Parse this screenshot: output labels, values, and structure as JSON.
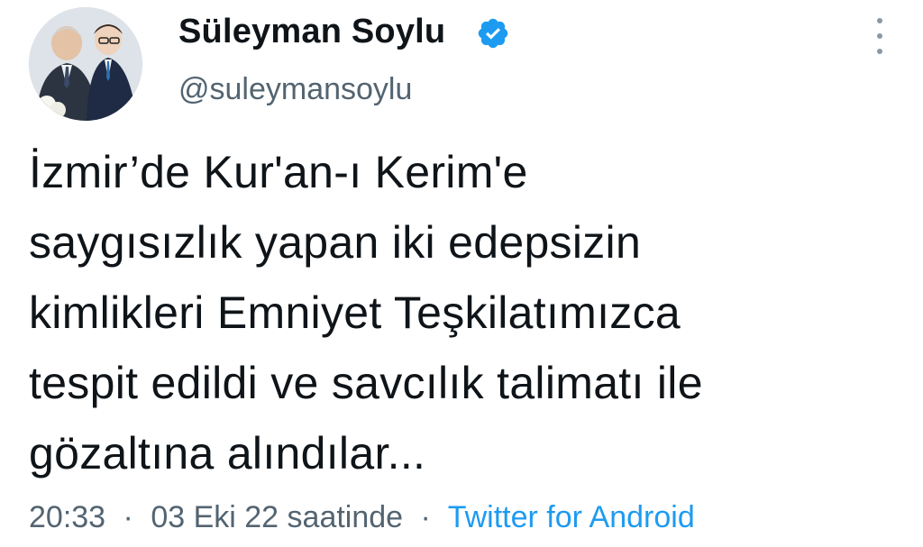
{
  "author": {
    "display_name": "Süleyman Soylu",
    "handle": "@suleymansoylu",
    "verified_icon": "verified-badge-icon",
    "avatar_icon": "profile-photo"
  },
  "tweet": {
    "lines": [
      "İzmir’de Kur'an-ı Kerim'e",
      "saygısızlık yapan iki edepsizin",
      "kimlikleri Emniyet Teşkilatımızca",
      "tespit edildi ve savcılık talimatı ile",
      "gözaltına alındılar..."
    ]
  },
  "meta": {
    "time": "20:33",
    "separator": "·",
    "date": "03 Eki 22 saatinde",
    "source": "Twitter for Android"
  },
  "colors": {
    "text": "#0f1419",
    "secondary": "#536471",
    "accent": "#1d9bf0"
  }
}
